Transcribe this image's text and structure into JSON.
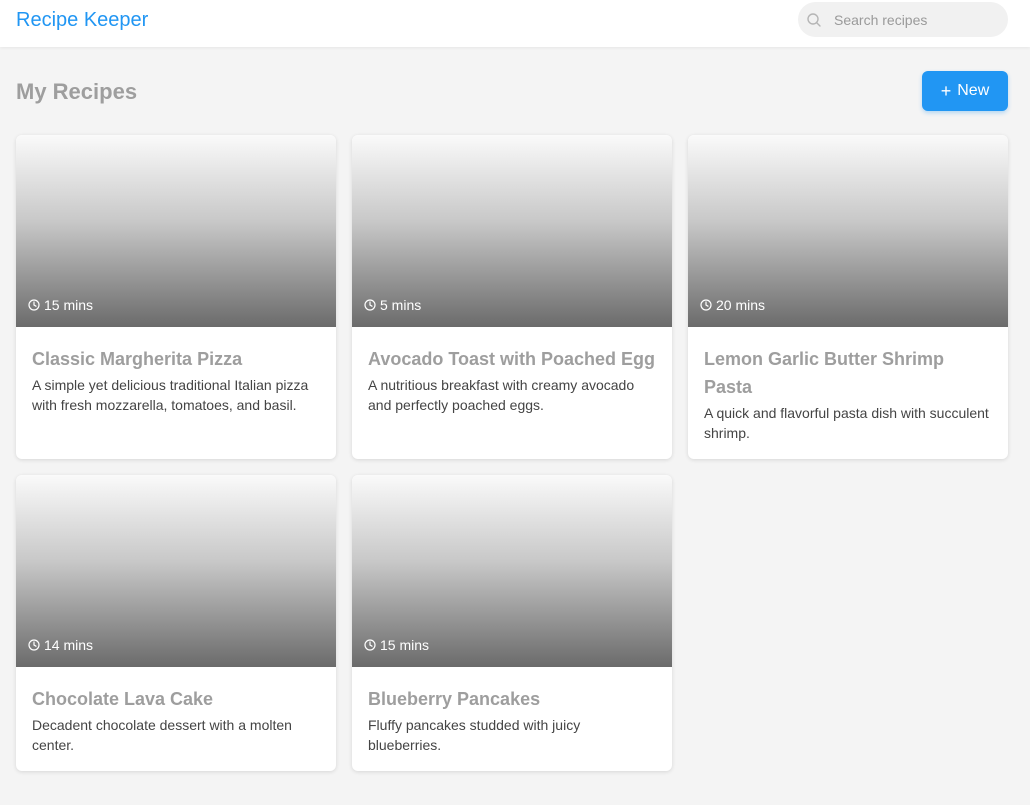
{
  "header": {
    "app_title": "Recipe Keeper",
    "search_placeholder": "Search recipes",
    "search_value": ""
  },
  "main": {
    "page_title": "My Recipes",
    "new_button_label": "New",
    "recipes": [
      {
        "time": "15 mins",
        "title": "Classic Margherita Pizza",
        "description": "A simple yet delicious traditional Italian pizza with fresh mozzarella, tomatoes, and basil."
      },
      {
        "time": "5 mins",
        "title": "Avocado Toast with Poached Egg",
        "description": "A nutritious breakfast with creamy avocado and perfectly poached eggs."
      },
      {
        "time": "20 mins",
        "title": "Lemon Garlic Butter Shrimp Pasta",
        "description": "A quick and flavorful pasta dish with succulent shrimp."
      },
      {
        "time": "14 mins",
        "title": "Chocolate Lava Cake",
        "description": "Decadent chocolate dessert with a molten center."
      },
      {
        "time": "15 mins",
        "title": "Blueberry Pancakes",
        "description": "Fluffy pancakes studded with juicy blueberries."
      }
    ]
  },
  "icons": {
    "search": "search-icon",
    "clock": "clock-icon",
    "plus": "plus-icon"
  },
  "colors": {
    "accent": "#2196f3",
    "background": "#f4f4f4",
    "card_title": "#9e9e9e"
  }
}
